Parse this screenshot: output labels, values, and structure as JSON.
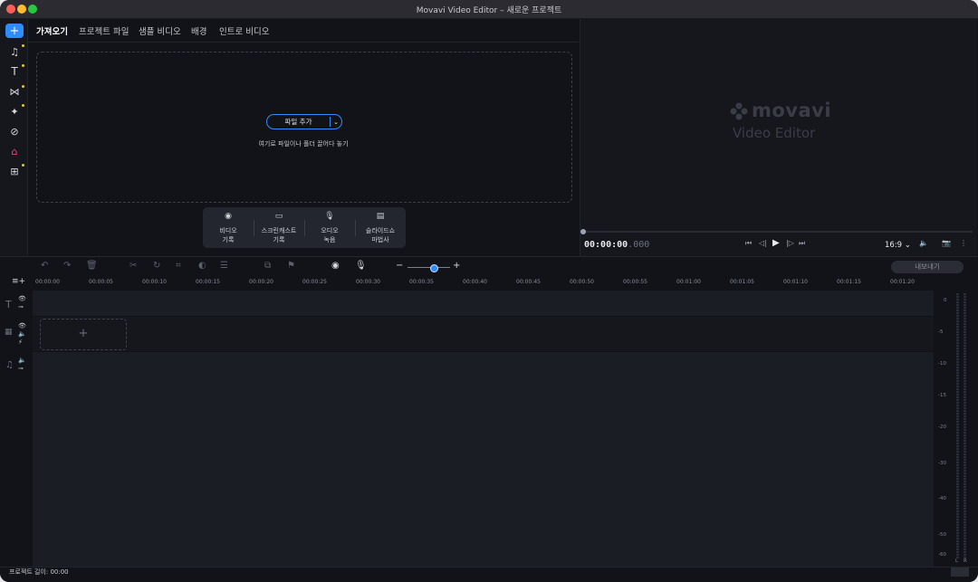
{
  "window": {
    "title": "Movavi Video Editor – 새로운 프로젝트"
  },
  "left_toolbar": {
    "items": [
      "add-icon",
      "music-icon",
      "text-icon",
      "transitions-icon",
      "effects-icon",
      "sticker-icon",
      "elements-icon",
      "more-tools-icon"
    ]
  },
  "import_tabs": {
    "items": [
      "가져오기",
      "프로젝트 파일",
      "샘플 비디오",
      "배경",
      "인트로 비디오"
    ]
  },
  "import": {
    "add_file_label": "파일 추가",
    "drop_hint": "여기로 파일이나 폴더 끌어다 놓기"
  },
  "record": {
    "items": [
      {
        "line1": "비디오",
        "line2": "기록"
      },
      {
        "line1": "스크린캐스트",
        "line2": "기록"
      },
      {
        "line1": "오디오",
        "line2": "녹음"
      },
      {
        "line1": "슬라이드쇼",
        "line2": "마법사"
      }
    ]
  },
  "player": {
    "logo_name": "movavi",
    "logo_sub": "Video Editor",
    "timecode_main": "00:00:00",
    "timecode_ms": ".000",
    "aspect_ratio": "16:9 ⌄"
  },
  "timeline": {
    "export_label": "내보내기",
    "ruler_ticks": [
      "00:00:00",
      "00:00:05",
      "00:00:10",
      "00:00:15",
      "00:00:20",
      "00:00:25",
      "00:00:30",
      "00:00:35",
      "00:00:40",
      "00:00:45",
      "00:00:50",
      "00:00:55",
      "00:01:00",
      "00:01:05",
      "00:01:10",
      "00:01:15",
      "00:01:20"
    ],
    "add_clip": "+"
  },
  "meter": {
    "labels": [
      "0",
      "-5",
      "-10",
      "-15",
      "-20",
      "-30",
      "-40",
      "-50",
      "-60"
    ],
    "channels": [
      "L",
      "R"
    ]
  },
  "status": {
    "project_length": "프로젝트 길이: 00:00"
  },
  "colors": {
    "accent": "#2f8cff",
    "background": "#111319",
    "panel": "#15171d"
  }
}
